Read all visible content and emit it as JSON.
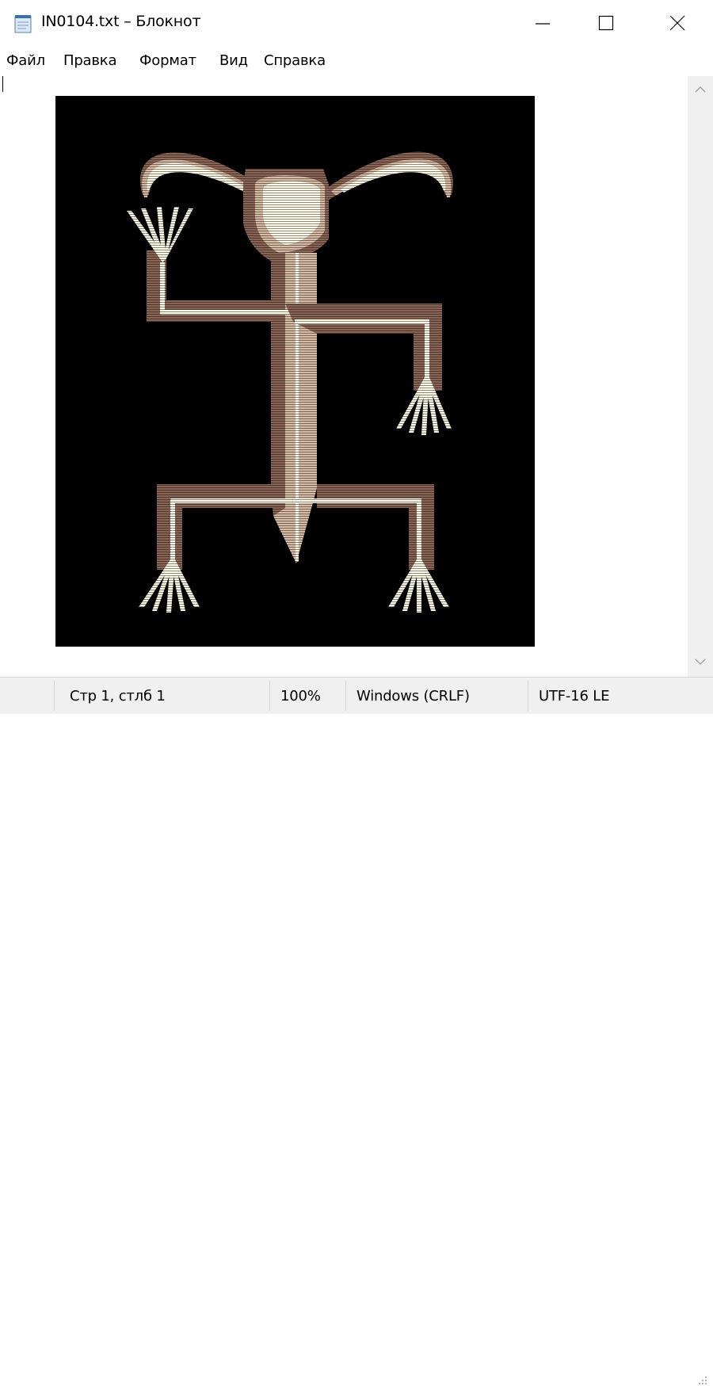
{
  "window": {
    "title": "IN0104.txt – Блокнот",
    "icon": "notepad-icon",
    "controls": [
      "minimize-icon",
      "maximize-icon",
      "close-icon"
    ]
  },
  "menu": {
    "items": [
      "Файл",
      "Правка",
      "Формат",
      "Вид",
      "Справка"
    ]
  },
  "editor": {
    "content_description_icon": "ascii-art-figure",
    "colors": {
      "background": "#000000",
      "fill_light": "#fffbe8",
      "fill_tan": "#d8bba4",
      "fill_brown": "#8a6555"
    }
  },
  "status": {
    "position": "Стр 1, стлб 1",
    "zoom": "100%",
    "line_ending": "Windows (CRLF)",
    "encoding": "UTF-16 LE"
  },
  "colors": {
    "titlebar": "#ffffff",
    "statusbar": "#f0f0f0",
    "scrollbar": "#f0f0f0"
  }
}
